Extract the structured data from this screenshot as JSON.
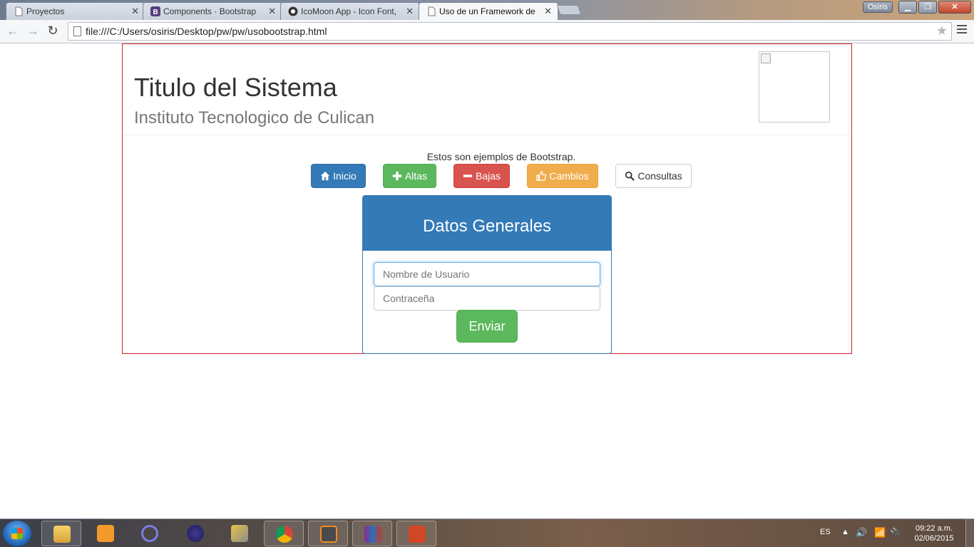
{
  "browser": {
    "tabs": [
      {
        "title": "Proyectos",
        "icon": "page-icon"
      },
      {
        "title": "Components · Bootstrap",
        "icon": "bootstrap-icon"
      },
      {
        "title": "IcoMoon App - Icon Font,",
        "icon": "icomoon-icon"
      },
      {
        "title": "Uso de un Framework de",
        "icon": "page-icon",
        "active": true
      }
    ],
    "user_badge": "Osiris",
    "address": "file:///C:/Users/osiris/Desktop/pw/pw/usobootstrap.html"
  },
  "page": {
    "title": "Titulo del Sistema",
    "subtitle": "Instituto Tecnologico de Culican",
    "intro": "Estos son ejemplos de Bootstrap.",
    "buttons": {
      "inicio": {
        "label": "Inicio",
        "icon": "home-icon"
      },
      "altas": {
        "label": "Altas",
        "icon": "plus-icon"
      },
      "bajas": {
        "label": "Bajas",
        "icon": "minus-icon"
      },
      "cambios": {
        "label": "Cambios",
        "icon": "thumbs-up-icon"
      },
      "consultas": {
        "label": "Consultas",
        "icon": "search-icon"
      }
    },
    "panel": {
      "heading": "Datos Generales",
      "username_placeholder": "Nombre de Usuario",
      "password_placeholder": "Contraceña",
      "submit_label": "Enviar"
    }
  },
  "taskbar": {
    "language": "ES",
    "time": "09:22 a.m.",
    "date": "02/06/2015"
  },
  "colors": {
    "primary": "#337ab7",
    "success": "#5cb85c",
    "danger": "#d9534f",
    "warning": "#f0ad4e",
    "container_border": "#d9232e"
  }
}
